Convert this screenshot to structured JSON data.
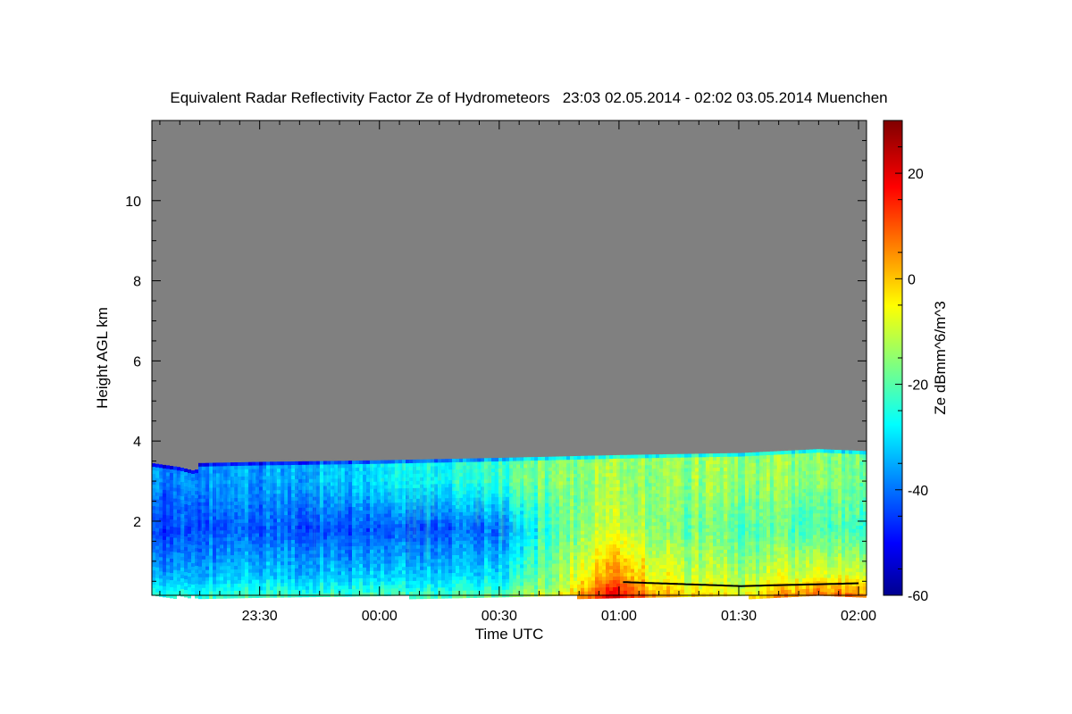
{
  "chart_data": {
    "type": "heatmap",
    "title": "Equivalent Radar Reflectivity Factor Ze of Hydrometeors   23:03 02.05.2014 - 02:02 03.05.2014 Muenchen",
    "xlabel": "Time UTC",
    "ylabel": "Height AGL km",
    "xlim": [
      "23:03",
      "02:02"
    ],
    "ylim": [
      0.15,
      12.0
    ],
    "x_ticks": [
      "23:30",
      "00:00",
      "00:30",
      "01:00",
      "01:30",
      "02:00"
    ],
    "y_ticks": [
      2,
      4,
      6,
      8,
      10
    ],
    "colorbar": {
      "label": "Ze dBmm^6/m^3",
      "range": [
        -60,
        30
      ],
      "ticks": [
        -60,
        -40,
        -20,
        0,
        20
      ]
    },
    "no_data_color": "#808080",
    "echo_top_km": [
      {
        "time": "23:03",
        "top": 3.45
      },
      {
        "time": "23:10",
        "top": 3.35
      },
      {
        "time": "23:14",
        "top": 3.25
      },
      {
        "time": "23:15",
        "top": 3.45
      },
      {
        "time": "23:30",
        "top": 3.48
      },
      {
        "time": "00:00",
        "top": 3.52
      },
      {
        "time": "00:30",
        "top": 3.58
      },
      {
        "time": "01:00",
        "top": 3.65
      },
      {
        "time": "01:30",
        "top": 3.7
      },
      {
        "time": "01:50",
        "top": 3.8
      },
      {
        "time": "02:02",
        "top": 3.75
      }
    ],
    "ze_dbz": [
      {
        "time": "23:05",
        "upper_cloud": -38,
        "mid_layer": -45,
        "near_surface": -28
      },
      {
        "time": "23:30",
        "upper_cloud": -36,
        "mid_layer": -42,
        "near_surface": -25
      },
      {
        "time": "00:00",
        "upper_cloud": -30,
        "mid_layer": -44,
        "near_surface": -25
      },
      {
        "time": "00:30",
        "upper_cloud": -22,
        "mid_layer": -40,
        "near_surface": -22
      },
      {
        "time": "00:45",
        "upper_cloud": -15,
        "mid_layer": -20,
        "near_surface": -10
      },
      {
        "time": "00:58",
        "upper_cloud": -14,
        "mid_layer": -10,
        "near_surface": 15
      },
      {
        "time": "01:15",
        "upper_cloud": -15,
        "mid_layer": -18,
        "near_surface": -5
      },
      {
        "time": "01:30",
        "upper_cloud": -14,
        "mid_layer": -20,
        "near_surface": -8
      },
      {
        "time": "01:50",
        "upper_cloud": -16,
        "mid_layer": -22,
        "near_surface": 5
      },
      {
        "time": "02:02",
        "upper_cloud": -20,
        "mid_layer": -25,
        "near_surface": 0
      }
    ],
    "layer_heights_km": {
      "upper_cloud": 3.0,
      "mid_layer": 1.8,
      "near_surface": 0.25
    },
    "black_line": {
      "start": "01:01",
      "end": "02:00",
      "height_km": [
        0.48,
        0.38,
        0.45
      ]
    }
  }
}
